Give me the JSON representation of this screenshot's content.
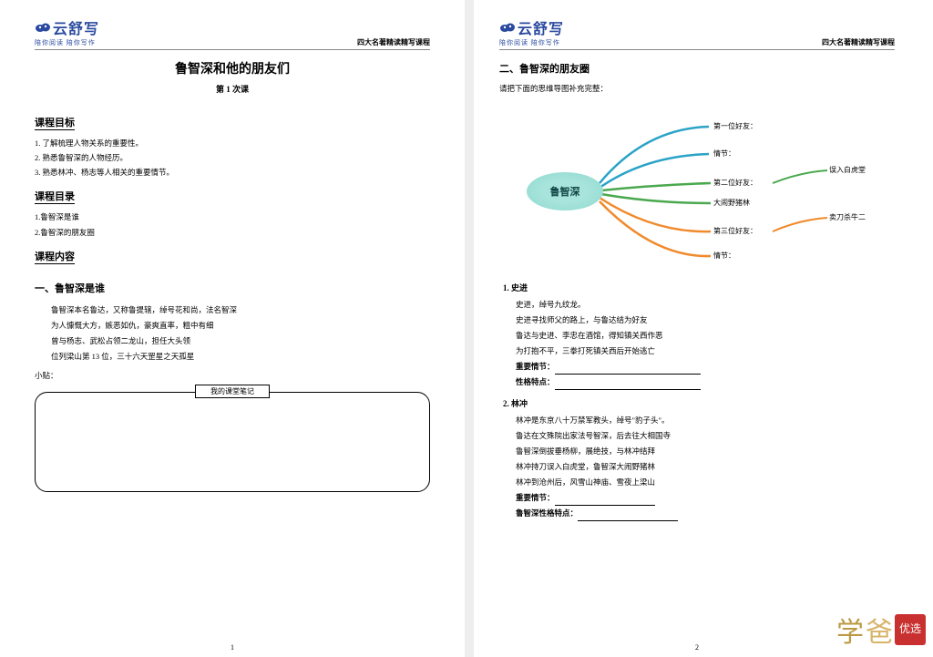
{
  "brand": {
    "name": "云舒写",
    "tagline": "陪你阅读 陪你写作"
  },
  "header_right": "四大名著精读精写课程",
  "page1": {
    "title": "鲁智深和他的朋友们",
    "subtitle": "第 1 次课",
    "sec_goal": "课程目标",
    "goals": [
      "1. 了解梳理人物关系的重要性。",
      "2. 熟悉鲁智深的人物经历。",
      "3. 熟悉林冲、杨志等人相关的重要情节。"
    ],
    "sec_toc": "课程目录",
    "toc": [
      "1.鲁智深是谁",
      "2.鲁智深的朋友圈"
    ],
    "sec_content": "课程内容",
    "h1": "一、鲁智深是谁",
    "intro": [
      "鲁智深本名鲁达，又称鲁提辖，绰号花和尚，法名智深",
      "为人慷慨大方，嫉恶如仇，豪爽直率，粗中有细",
      "曾与杨志、武松占领二龙山，担任大头领",
      "位列梁山第 13 位，三十六天罡星之天孤星"
    ],
    "tip_label": "小贴：",
    "notes_title": "我的课堂笔记",
    "pagenum": "1"
  },
  "page2": {
    "h2": "二、鲁智深的朋友圈",
    "instruction": "请把下面的思维导图补充完整：",
    "mindmap": {
      "center": "鲁智深",
      "b1a": "第一位好友：",
      "b1b": "情节：",
      "b2a": "第二位好友：",
      "b2b": "大闹野猪林",
      "b2c": "误入白虎堂",
      "b3a": "第三位好友：",
      "b3b": "情节：",
      "b3c": "卖刀杀牛二"
    },
    "p1_title": "1. 史进",
    "p1_lines": [
      "史进，绰号九纹龙。",
      "史进寻找师父的路上，与鲁达结为好友",
      "鲁达与史进、李忠在酒馆，得知镇关西作恶",
      "为打抱不平，三拳打死镇关西后开始逃亡"
    ],
    "key_plot": "重要情节：",
    "trait": "性格特点：",
    "p2_title": "2. 林冲",
    "p2_lines": [
      "林冲是东京八十万禁军教头，绰号\"豹子头\"。",
      "鲁达在文殊院出家法号智深，后去往大相国寺",
      "鲁智深倒拔垂杨柳，展绝技，与林冲结拜",
      "林冲持刀误入白虎堂，鲁智深大闹野猪林",
      "林冲到沧州后，风雪山神庙、雪夜上梁山"
    ],
    "lz_trait": "鲁智深性格特点：",
    "pagenum": "2"
  },
  "watermark": {
    "a": "学",
    "b": "爸",
    "seal": "优选"
  }
}
